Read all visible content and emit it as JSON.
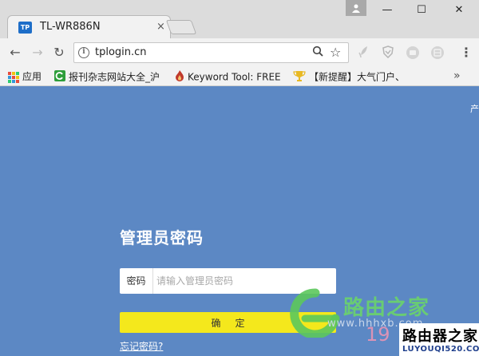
{
  "browser": {
    "tab": {
      "favicon_text": "TP",
      "title": "TL-WR886N",
      "close": "×"
    },
    "window_controls": {
      "minimize": "—",
      "maximize": "☐",
      "close": "✕"
    },
    "nav": {
      "back": "←",
      "forward": "→",
      "reload": "↻"
    },
    "address": {
      "url": "tplogin.cn",
      "info_glyph": "i"
    },
    "menu": "⋮"
  },
  "bookmarks": {
    "items": [
      {
        "label": "应用"
      },
      {
        "label": "报刊杂志网站大全_沪"
      },
      {
        "label": "Keyword Tool: FREE"
      },
      {
        "label": "【新提醒】大气门户、"
      }
    ],
    "more": "»"
  },
  "page": {
    "corner_text": "产",
    "title": "管理员密码",
    "password_label": "密码",
    "password_placeholder": "请输入管理员密码",
    "password_value": "",
    "confirm_button": "确定",
    "forgot_link": "忘记密码?"
  },
  "watermark": {
    "title": "路由之家",
    "url": "www.hhhxb.com",
    "number": "19",
    "stamp_title": "路由器之家",
    "stamp_url": "LUYOUQI520.COM"
  },
  "colors": {
    "page_background": "#5c88c4",
    "confirm_button": "#f4e81c",
    "tab_favicon": "#1e6ec8"
  }
}
